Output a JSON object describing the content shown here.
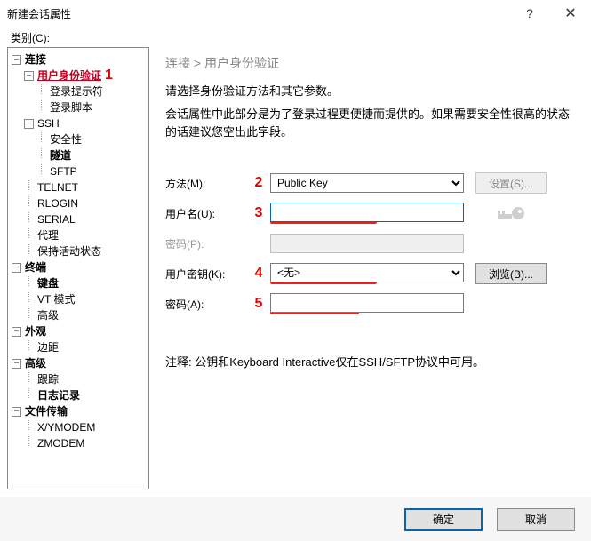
{
  "window": {
    "title": "新建会话属性",
    "help": "?",
    "close": "✕"
  },
  "category_label": "类别(C):",
  "tree": {
    "connection": "连接",
    "auth": "用户身份验证",
    "login_prompt": "登录提示符",
    "login_script": "登录脚本",
    "ssh": "SSH",
    "security": "安全性",
    "tunnel": "隧道",
    "sftp": "SFTP",
    "telnet": "TELNET",
    "rlogin": "RLOGIN",
    "serial": "SERIAL",
    "proxy": "代理",
    "keepalive": "保持活动状态",
    "terminal": "终端",
    "keyboard": "键盘",
    "vt": "VT 模式",
    "advanced_t": "高级",
    "appearance": "外观",
    "margin": "边距",
    "advanced": "高级",
    "trace": "跟踪",
    "log": "日志记录",
    "transfer": "文件传输",
    "xymodem": "X/YMODEM",
    "zmodem": "ZMODEM"
  },
  "breadcrumb": "连接  >  用户身份验证",
  "desc1": "请选择身份验证方法和其它参数。",
  "desc2": "会话属性中此部分是为了登录过程更便捷而提供的。如果需要安全性很高的状态的话建议您空出此字段。",
  "form": {
    "method_label": "方法(M):",
    "method_value": "Public Key",
    "settings_btn": "设置(S)...",
    "user_label": "用户名(U):",
    "user_value": "",
    "pwd_label": "密码(P):",
    "pwd_value": "",
    "userkey_label": "用户密钥(K):",
    "userkey_value": "<无>",
    "browse_btn": "浏览(B)...",
    "pwd2_label": "密码(A):",
    "pwd2_value": ""
  },
  "annotations": {
    "a1": "1",
    "a2": "2",
    "a3": "3",
    "a4": "4",
    "a5": "5"
  },
  "note": "注释: 公钥和Keyboard Interactive仅在SSH/SFTP协议中可用。",
  "buttons": {
    "ok": "确定",
    "cancel": "取消"
  }
}
